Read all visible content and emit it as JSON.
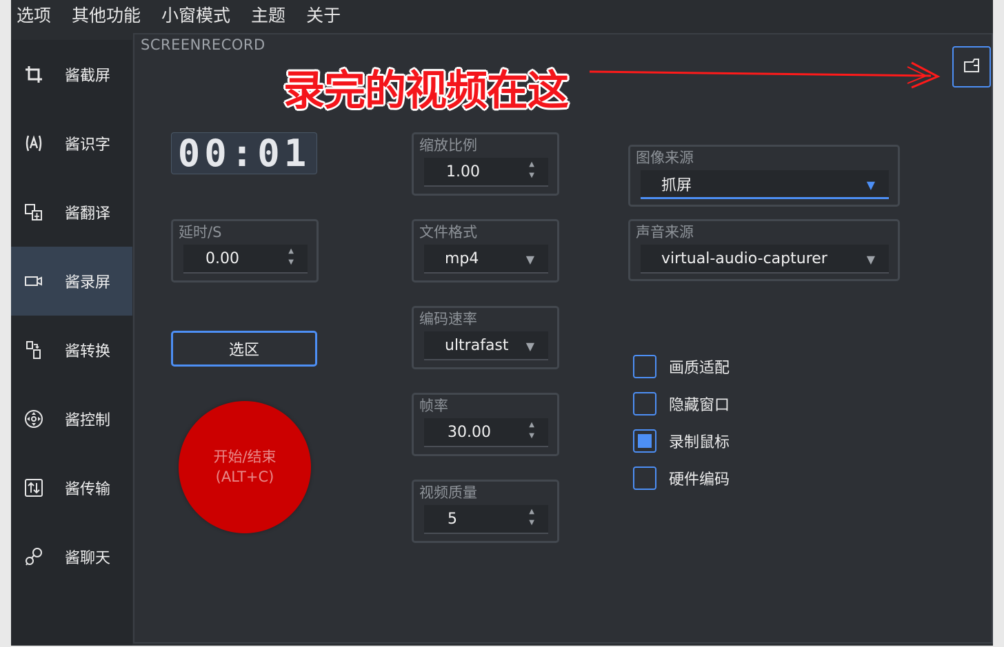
{
  "menu": [
    "选项",
    "其他功能",
    "小窗模式",
    "主题",
    "关于"
  ],
  "sidebar": {
    "items": [
      {
        "label": "酱截屏",
        "icon": "crop-icon"
      },
      {
        "label": "酱识字",
        "icon": "text-recognition-icon"
      },
      {
        "label": "酱翻译",
        "icon": "translate-icon"
      },
      {
        "label": "酱录屏",
        "icon": "video-camera-icon",
        "active": true
      },
      {
        "label": "酱转换",
        "icon": "file-convert-icon"
      },
      {
        "label": "酱控制",
        "icon": "remote-control-icon"
      },
      {
        "label": "酱传输",
        "icon": "transfer-icon"
      },
      {
        "label": "酱聊天",
        "icon": "chat-icon"
      }
    ]
  },
  "main": {
    "title": "SCREENRECORD",
    "annotation": "录完的视频在这",
    "folder_icon": "folder-open-icon",
    "timer": "00:01",
    "delay": {
      "label": "延时/S",
      "value": "0.00"
    },
    "select_area": "选区",
    "record": {
      "line1": "开始/结束",
      "line2": "(ALT+C)"
    },
    "scale": {
      "label": "缩放比例",
      "value": "1.00"
    },
    "format": {
      "label": "文件格式",
      "value": "mp4"
    },
    "preset": {
      "label": "编码速率",
      "value": "ultrafast"
    },
    "fps": {
      "label": "帧率",
      "value": "30.00"
    },
    "quality": {
      "label": "视频质量",
      "value": "5"
    },
    "image_source": {
      "label": "图像来源",
      "value": "抓屏"
    },
    "audio_source": {
      "label": "声音来源",
      "value": "virtual-audio-capturer"
    },
    "checks": [
      {
        "label": "画质适配",
        "checked": false
      },
      {
        "label": "隐藏窗口",
        "checked": false
      },
      {
        "label": "录制鼠标",
        "checked": true
      },
      {
        "label": "硬件编码",
        "checked": false
      }
    ]
  },
  "colors": {
    "accent": "#4d8ff5",
    "record": "#cc0000",
    "annotation": "#f4151b",
    "background": "#2d3035"
  }
}
